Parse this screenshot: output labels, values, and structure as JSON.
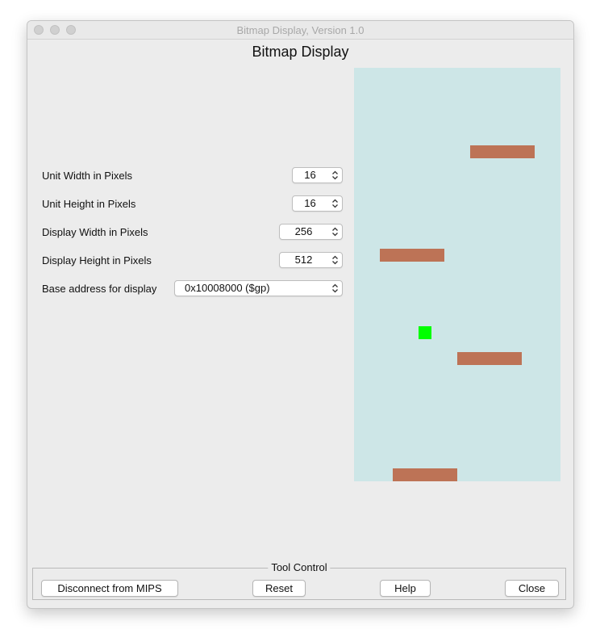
{
  "window": {
    "title": "Bitmap Display, Version 1.0",
    "heading": "Bitmap Display"
  },
  "settings": {
    "unit_width": {
      "label": "Unit Width in Pixels",
      "value": "16"
    },
    "unit_height": {
      "label": "Unit Height in Pixels",
      "value": "16"
    },
    "display_width": {
      "label": "Display Width in Pixels",
      "value": "256"
    },
    "display_height": {
      "label": "Display Height in Pixels",
      "value": "512"
    },
    "base_address": {
      "label": "Base address for display",
      "value": "0x10008000 ($gp)"
    }
  },
  "display": {
    "background_color": "#cde6e7",
    "platform_color": "#bd7356",
    "player_color": "#00ff00"
  },
  "tool_control": {
    "legend": "Tool Control",
    "disconnect_label": "Disconnect from MIPS",
    "reset_label": "Reset",
    "help_label": "Help",
    "close_label": "Close"
  },
  "icons": {
    "window_controls": [
      "close-icon",
      "minimize-icon",
      "zoom-icon"
    ],
    "spinner_arrows": "up-down-arrows-icon"
  }
}
